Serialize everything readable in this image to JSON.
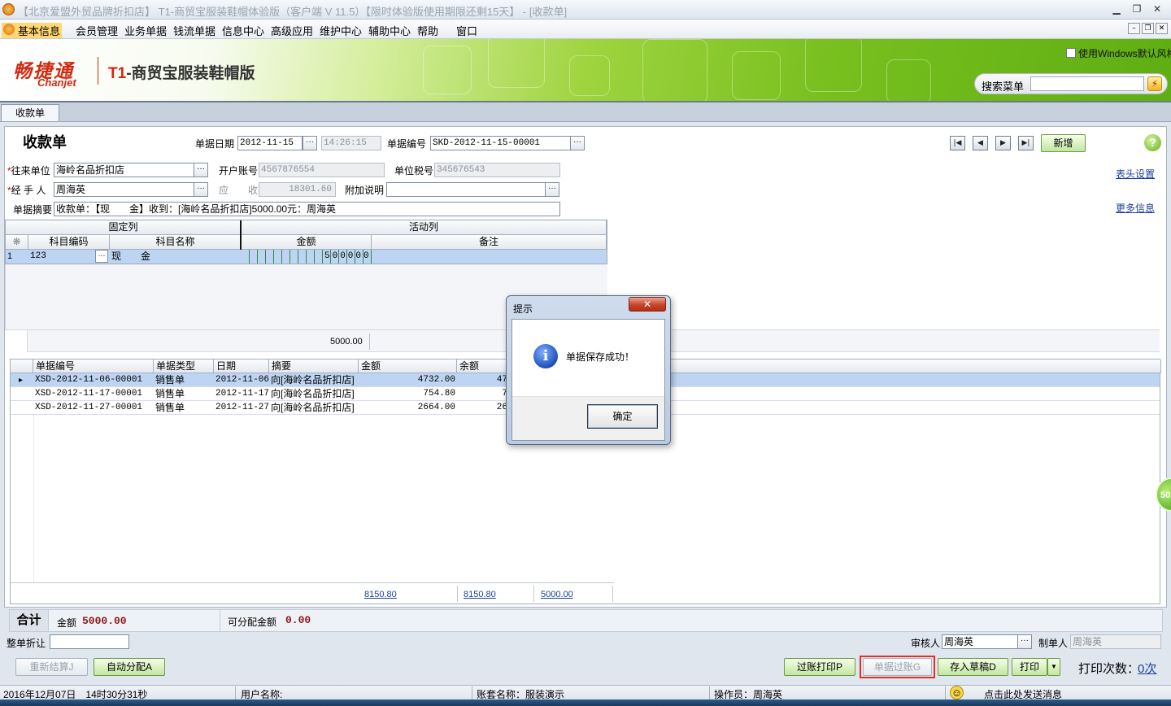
{
  "window": {
    "title": "【北京爱盟外贸品牌折扣店】 T1-商贸宝服装鞋帽体验版（客户端 V 11.5）【限时体验版使用期限还剩15天】 - [收款单]",
    "minimize": "▁",
    "restore": "❐",
    "close": "✕"
  },
  "menu": {
    "items": [
      "基本信息",
      "会员管理",
      "业务单据",
      "钱流单据",
      "信息中心",
      "高级应用",
      "维护中心",
      "辅助中心",
      "帮助",
      "窗口"
    ],
    "mdi_min": "–",
    "mdi_restore": "❐",
    "mdi_close": "✕"
  },
  "banner": {
    "brand_cn": "畅捷通",
    "brand_en": "Chanjet",
    "product_t1": "T1",
    "product_name": "-商贸宝服装鞋帽版",
    "windows_style_label": "使用Windows默认风格",
    "search_label": "搜索菜单",
    "search_value": "",
    "search_go": "⚡"
  },
  "tabs": [
    "收款单"
  ],
  "form": {
    "title": "收款单",
    "date_label": "单据日期",
    "date_value": "2012-11-15",
    "time_value": "14:26:15",
    "number_label": "单据编号",
    "number_value": "SKD-2012-11-15-00001",
    "new_button": "新增",
    "help": "?",
    "partner_label": "往来单位",
    "partner_value": "海岭名品折扣店",
    "account_label": "开户账号",
    "account_value": "4567876554",
    "tax_label": "单位税号",
    "tax_value": "345676543",
    "handler_label": "经 手 人",
    "handler_value": "周海英",
    "receivable_label": "应　　收",
    "receivable_value": "18301.60",
    "note_label": "附加说明",
    "note_value": "",
    "summary_label": "单据摘要",
    "summary_value": "收款单：【现　　金】收到：[海岭名品折扣店]5000.00元：周海英",
    "header_settings_link": "表头设置",
    "more_info_link": "更多信息",
    "ellipsis": "···",
    "required_mark": "*"
  },
  "nav_buttons": [
    "|◀",
    "◀",
    "▶",
    "▶|"
  ],
  "grid1": {
    "group_fixed": "固定列",
    "group_active": "活动列",
    "corner": "❋",
    "columns": [
      "科目编码",
      "科目名称",
      "金额",
      "备注"
    ],
    "rows": [
      {
        "no": "1",
        "code": "123",
        "name": "现　　金",
        "amount_digits": "500000",
        "remark": ""
      }
    ],
    "sum_amount": "5000.00"
  },
  "grid2": {
    "columns": [
      "单据编号",
      "单据类型",
      "日期",
      "摘要",
      "金额",
      "余额"
    ],
    "rows": [
      {
        "number": "XSD-2012-11-06-00001",
        "type": "销售单",
        "date": "2012-11-06",
        "summary": "向[海岭名品折扣店]",
        "amount": "4732.00",
        "balance": "47"
      },
      {
        "number": "XSD-2012-11-17-00001",
        "type": "销售单",
        "date": "2012-11-17",
        "summary": "向[海岭名品折扣店]",
        "amount": "754.80",
        "balance": "7"
      },
      {
        "number": "XSD-2012-11-27-00001",
        "type": "销售单",
        "date": "2012-11-27",
        "summary": "向[海岭名品折扣店]",
        "amount": "2664.00",
        "balance": "26"
      }
    ],
    "totals": [
      "8150.80",
      "8150.80",
      "5000.00"
    ],
    "row_marker": "▸"
  },
  "totals_bar": {
    "label": "合计",
    "amount_label": "金额",
    "amount_value": "5000.00",
    "allocatable_label": "可分配金额",
    "allocatable_value": "0.00"
  },
  "bottom": {
    "discount_label": "整单折让",
    "discount_value": "",
    "auditor_label": "审核人",
    "auditor_value": "周海英",
    "maker_label": "制单人",
    "maker_value": "周海英",
    "recalc_button": "重新结算J",
    "auto_allocate_button": "自动分配A",
    "post_print_button": "过账打印P",
    "post_button": "单据过账G",
    "save_draft_button": "存入草稿D",
    "print_button": "打印",
    "print_dropdown": "▼",
    "print_count_label": "打印次数：",
    "print_count_value": "0次"
  },
  "statusbar": {
    "datetime": "2016年12月07日　14时30分31秒",
    "user_label": "用户名称:",
    "account_set": "账套名称：服装演示",
    "operator": "操作员：周海英",
    "smiley": "☺",
    "message": "点击此处发送消息"
  },
  "side_badge": "50",
  "dialog": {
    "title": "提示",
    "close": "✕",
    "icon_glyph": "i",
    "message": "单据保存成功！",
    "ok_button": "确定"
  },
  "colors": {
    "accent_green": "#79c01f",
    "brand_red": "#d02a10",
    "selected_row": "#bdd5f3",
    "highlight_border": "#e0302a"
  }
}
